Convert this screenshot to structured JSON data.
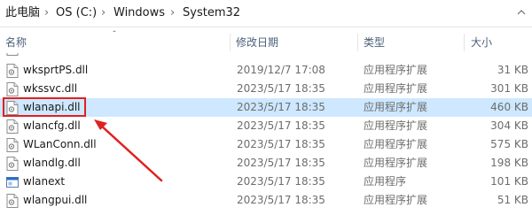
{
  "breadcrumb": {
    "items": [
      {
        "label": "此电脑"
      },
      {
        "label": "OS (C:)"
      },
      {
        "label": "Windows"
      },
      {
        "label": "System32"
      }
    ],
    "separator": "›"
  },
  "columns": {
    "name": "名称",
    "date": "修改日期",
    "type": "类型",
    "size": "大小"
  },
  "files": [
    {
      "name": "wksprtPS.dll",
      "date": "2019/12/7 17:08",
      "type": "应用程序扩展",
      "size": "31 KB",
      "icon": "dll-file-icon",
      "selected": false
    },
    {
      "name": "wkssvc.dll",
      "date": "2023/5/17 18:35",
      "type": "应用程序扩展",
      "size": "301 KB",
      "icon": "dll-file-icon",
      "selected": false
    },
    {
      "name": "wlanapi.dll",
      "date": "2023/5/17 18:35",
      "type": "应用程序扩展",
      "size": "460 KB",
      "icon": "dll-file-icon",
      "selected": true
    },
    {
      "name": "wlancfg.dll",
      "date": "2023/5/17 18:35",
      "type": "应用程序扩展",
      "size": "304 KB",
      "icon": "dll-file-icon",
      "selected": false
    },
    {
      "name": "WLanConn.dll",
      "date": "2023/5/17 18:35",
      "type": "应用程序扩展",
      "size": "575 KB",
      "icon": "dll-file-icon",
      "selected": false
    },
    {
      "name": "wlandlg.dll",
      "date": "2023/5/17 18:35",
      "type": "应用程序扩展",
      "size": "198 KB",
      "icon": "dll-file-icon",
      "selected": false
    },
    {
      "name": "wlanext",
      "date": "2023/5/17 18:35",
      "type": "应用程序",
      "size": "101 KB",
      "icon": "exe-app-icon",
      "selected": false
    },
    {
      "name": "wlangpui.dll",
      "date": "2023/5/17 18:35",
      "type": "应用程序扩展",
      "size": "51 KB",
      "icon": "dll-file-icon",
      "selected": false
    }
  ],
  "annotation": {
    "color": "#e02020"
  },
  "colors": {
    "selection": "#cde8ff",
    "header_text": "#4c607a"
  }
}
